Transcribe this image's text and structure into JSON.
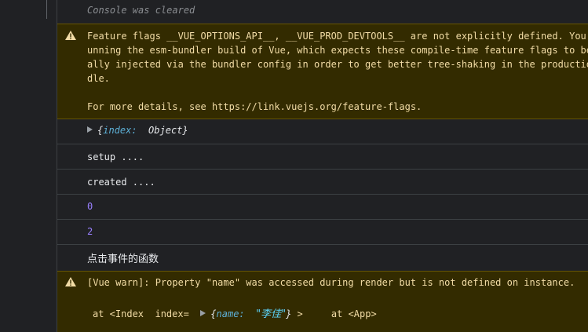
{
  "console_cleared": "Console was cleared",
  "feature_flags_warning": {
    "line1": "Feature flags __VUE_OPTIONS_API__, __VUE_PROD_DEVTOOLS__ are not explicitly defined. You ar",
    "line2": "unning the esm-bundler build of Vue, which expects these compile-time feature flags to be g",
    "line3": "ally injected via the bundler config in order to get better tree-shaking in the production ",
    "line4": "dle.",
    "details_prefix": "For more details, see ",
    "details_link": "https://link.vuejs.org/feature-flags."
  },
  "object_log": {
    "open_brace": "{",
    "key": "index:",
    "value": "Object",
    "close_brace": "}"
  },
  "logs": {
    "setup": "setup ....",
    "created": "created ....",
    "zero": "0",
    "two": "2",
    "click_fn": "点击事件的函数"
  },
  "vue_warn": {
    "message": "[Vue warn]: Property \"name\" was accessed during render but is not defined on instance.",
    "at_index": "at <Index  index=",
    "prop_open": "{",
    "prop_key": "name:",
    "prop_value": "\"李佳\"",
    "prop_close": "}",
    "component_close": ">",
    "at_app": "at <App>"
  },
  "colors": {
    "background": "#202124",
    "warning_bg": "#332b00",
    "warning_text": "#f2dca6",
    "number": "#9980ff",
    "object_key": "#5db0d7",
    "divider": "#3c4043"
  },
  "icons": [
    "warning-icon",
    "expand-triangle-icon"
  ]
}
